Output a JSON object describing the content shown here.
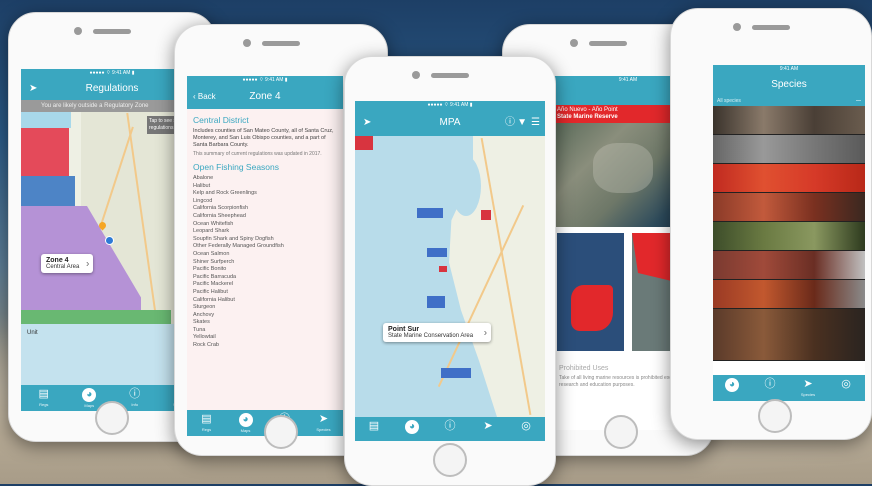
{
  "colors": {
    "accent": "#3aa7c0",
    "zone_red": "#e44a5a",
    "zone_blue": "#4d84c6",
    "zone_purple": "#b592d6",
    "zone_green": "#69b872",
    "alert_red": "#e2282b"
  },
  "phone1": {
    "title": "Regulations",
    "banner": "You are likely outside a Regulatory Zone",
    "tooltip": "Tap to see specific regulations",
    "callout": {
      "title": "Zone 4",
      "subtitle": "Central Area"
    },
    "lower_label": "Unit",
    "tabs": [
      {
        "icon": "book-icon",
        "label": "Regs"
      },
      {
        "icon": "fish-logo-icon",
        "label": "Maps"
      },
      {
        "icon": "info-icon",
        "label": "Info"
      },
      {
        "icon": "fish-icon",
        "label": "Species"
      }
    ]
  },
  "phone2": {
    "back_label": "Back",
    "title": "Zone 4",
    "section1_title": "Central District",
    "section1_text": "Includes counties of San Mateo County, all of Santa Cruz, Monterey, and San Luis Obispo counties, and a part of Santa Barbara County.",
    "section1_note": "This summary of current regulations was updated in 2017.",
    "section2_title": "Open Fishing Seasons",
    "species": [
      "Abalone",
      "Halibut",
      "Kelp and Rock Greenlings",
      "Lingcod",
      "California Scorpionfish",
      "California Sheephead",
      "Ocean Whitefish",
      "Leopard Shark",
      "Soupfin Shark and Spiny Dogfish",
      "Other Federally Managed Groundfish",
      "Ocean Salmon",
      "Shiner Surfperch",
      "Pacific Bonito",
      "Pacific Barracuda",
      "Pacific Mackerel",
      "Pacific Halibut",
      "California Halibut",
      "Sturgeon",
      "Anchovy",
      "Skates",
      "Tuna",
      "Yellowtail",
      "Rock Crab"
    ],
    "tabs": [
      {
        "icon": "book-icon",
        "label": "Regs"
      },
      {
        "icon": "fish-logo-icon",
        "label": "Maps"
      },
      {
        "icon": "info-icon",
        "label": "Regulations"
      },
      {
        "icon": "fish-icon",
        "label": "Species"
      }
    ]
  },
  "phone3": {
    "title": "MPA",
    "callout": {
      "title": "Point Sur",
      "subtitle": "State Marine Conservation Area"
    },
    "tabs": [
      {
        "icon": "book-icon",
        "label": ""
      },
      {
        "icon": "fish-logo-icon",
        "label": ""
      },
      {
        "icon": "info-icon",
        "label": ""
      },
      {
        "icon": "fish-icon",
        "label": ""
      },
      {
        "icon": "target-icon",
        "label": ""
      }
    ]
  },
  "phone4": {
    "alert_title": "Año Nuevo - Año Point",
    "alert_subtitle": "State Marine Reserve",
    "footer_title": "Prohibited Uses",
    "footer_text": "Take of all living marine resources is prohibited except for research and education purposes."
  },
  "phone5": {
    "title": "Species",
    "subheader": "All species",
    "tabs": [
      {
        "icon": "fish-logo-icon",
        "label": ""
      },
      {
        "icon": "info-icon",
        "label": ""
      },
      {
        "icon": "fish-icon",
        "label": "Species"
      },
      {
        "icon": "target-icon",
        "label": ""
      }
    ]
  }
}
